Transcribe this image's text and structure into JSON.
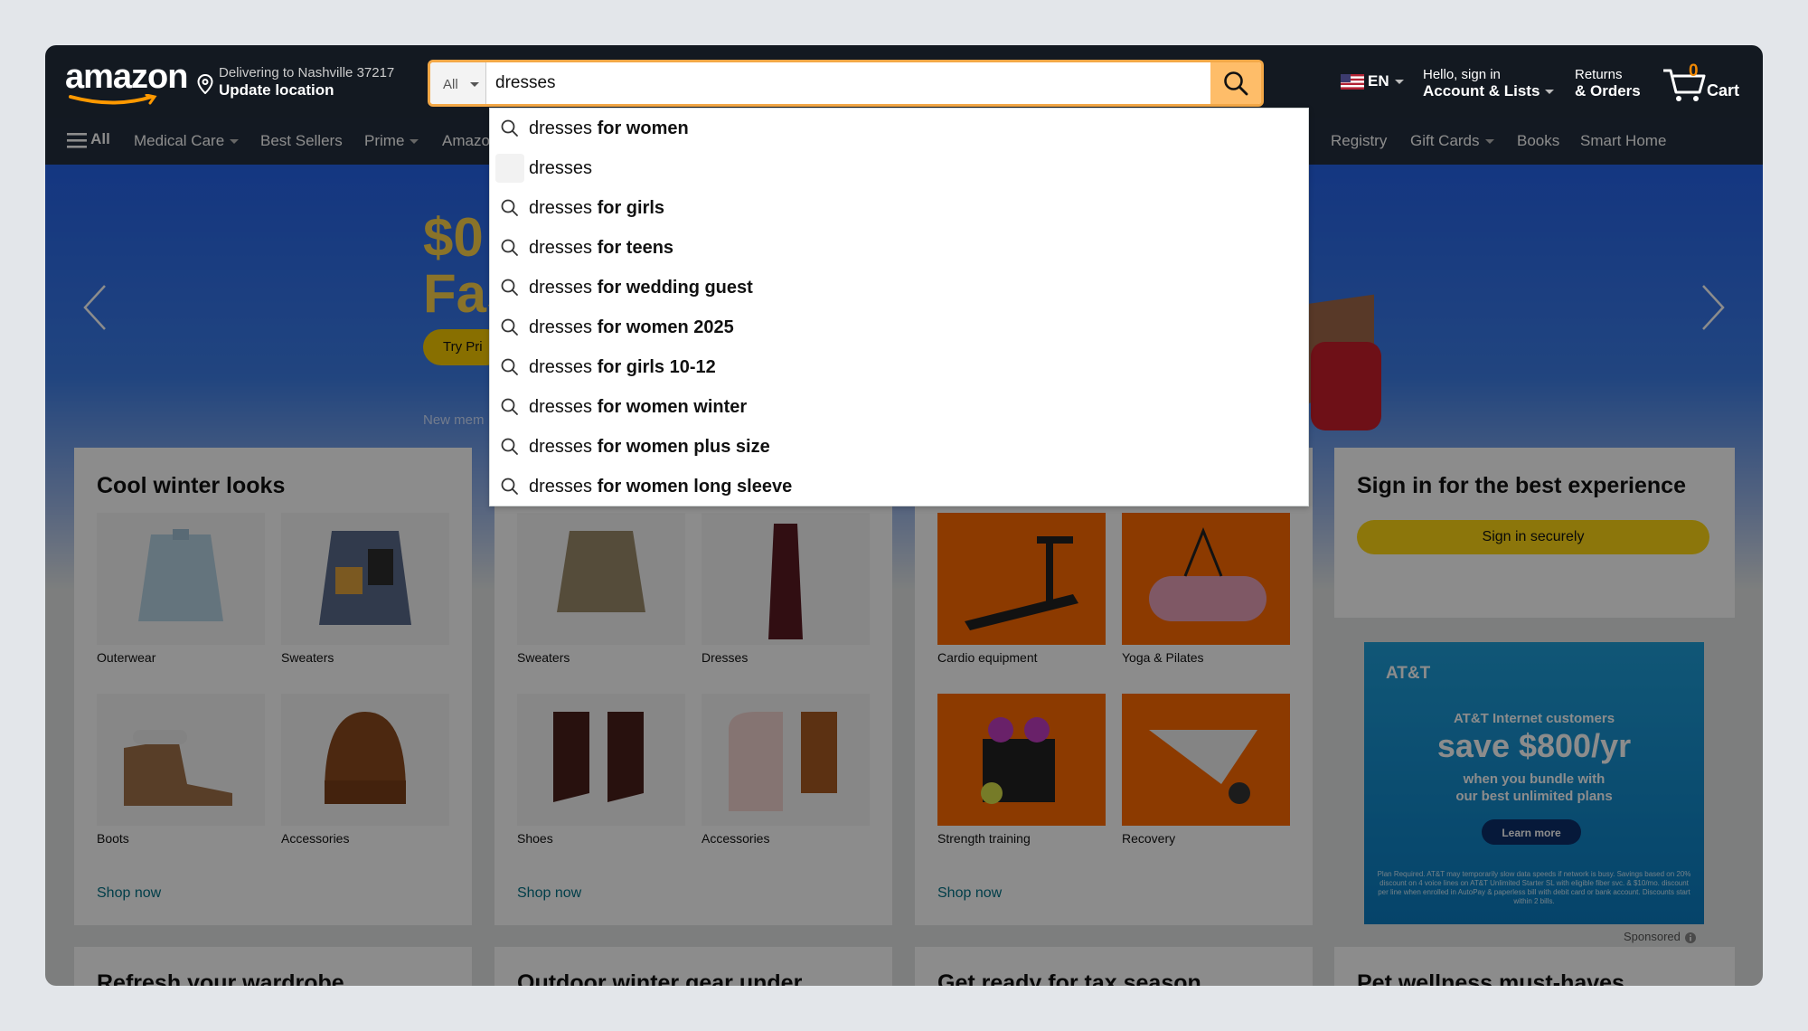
{
  "header": {
    "logo": "amazon",
    "deliver_line1": "Delivering to Nashville 37217",
    "deliver_line2": "Update location",
    "search_category": "All",
    "search_value": "dresses",
    "lang": "EN",
    "account_line1": "Hello, sign in",
    "account_line2": "Account & Lists",
    "returns_line1": "Returns",
    "returns_line2": "& Orders",
    "cart_count": "0",
    "cart_label": "Cart"
  },
  "nav": {
    "all": "All",
    "items": [
      "Medical Care",
      "Best Sellers",
      "Prime",
      "Amazon",
      "Registry",
      "Gift Cards",
      "Books",
      "Smart Home"
    ]
  },
  "hero": {
    "price_line1": "$0",
    "price_line2": "Fas",
    "button": "Try Pri",
    "note": "New mem"
  },
  "cards": [
    {
      "title": "Cool winter looks",
      "tiles": [
        "Outerwear",
        "Sweaters",
        "Boots",
        "Accessories"
      ],
      "link": "Shop now"
    },
    {
      "title": "",
      "tiles": [
        "Sweaters",
        "Dresses",
        "Shoes",
        "Accessories"
      ],
      "link": "Shop now"
    },
    {
      "title": "",
      "tiles": [
        "Cardio equipment",
        "Yoga & Pilates",
        "Strength training",
        "Recovery"
      ],
      "link": "Shop now"
    }
  ],
  "signin": {
    "title": "Sign in for the best experience",
    "button": "Sign in securely"
  },
  "ad": {
    "logo": "AT&T",
    "line1": "AT&T Internet customers",
    "line2": "save $800/yr",
    "line3a": "when you bundle with",
    "line3b": "our best unlimited plans",
    "button": "Learn more",
    "fine": "Plan Required. AT&T may temporarily slow data speeds if network is busy. Savings based on 20% discount on 4 voice lines on AT&T Unlimited Starter SL with eligible fiber svc. & $10/mo. discount per line when enrolled in AutoPay & paperless bill with debit card or bank account. Discounts start within 2 bills.",
    "sponsored": "Sponsored"
  },
  "row2": [
    "Refresh your wardrobe",
    "Outdoor winter gear under",
    "Get ready for tax season",
    "Pet wellness must-haves"
  ],
  "suggestions": [
    {
      "base": "dresses",
      "bold": " for women",
      "icon": "search"
    },
    {
      "base": "dresses",
      "bold": "",
      "icon": "blank"
    },
    {
      "base": "dresses",
      "bold": " for girls",
      "icon": "search"
    },
    {
      "base": "dresses",
      "bold": " for teens",
      "icon": "search"
    },
    {
      "base": "dresses",
      "bold": " for wedding guest",
      "icon": "search"
    },
    {
      "base": "dresses",
      "bold": " for women 2025",
      "icon": "search"
    },
    {
      "base": "dresses",
      "bold": " for girls 10-12",
      "icon": "search"
    },
    {
      "base": "dresses",
      "bold": " for women winter",
      "icon": "search"
    },
    {
      "base": "dresses",
      "bold": " for women plus size",
      "icon": "search"
    },
    {
      "base": "dresses",
      "bold": " for women long sleeve",
      "icon": "search"
    }
  ],
  "colors": {
    "header_bg": "#131921",
    "nav_bg": "#232f3e",
    "search_button": "#febd69",
    "accent_orange": "#f3a847",
    "signin_button": "#ffd814",
    "link": "#007185"
  }
}
